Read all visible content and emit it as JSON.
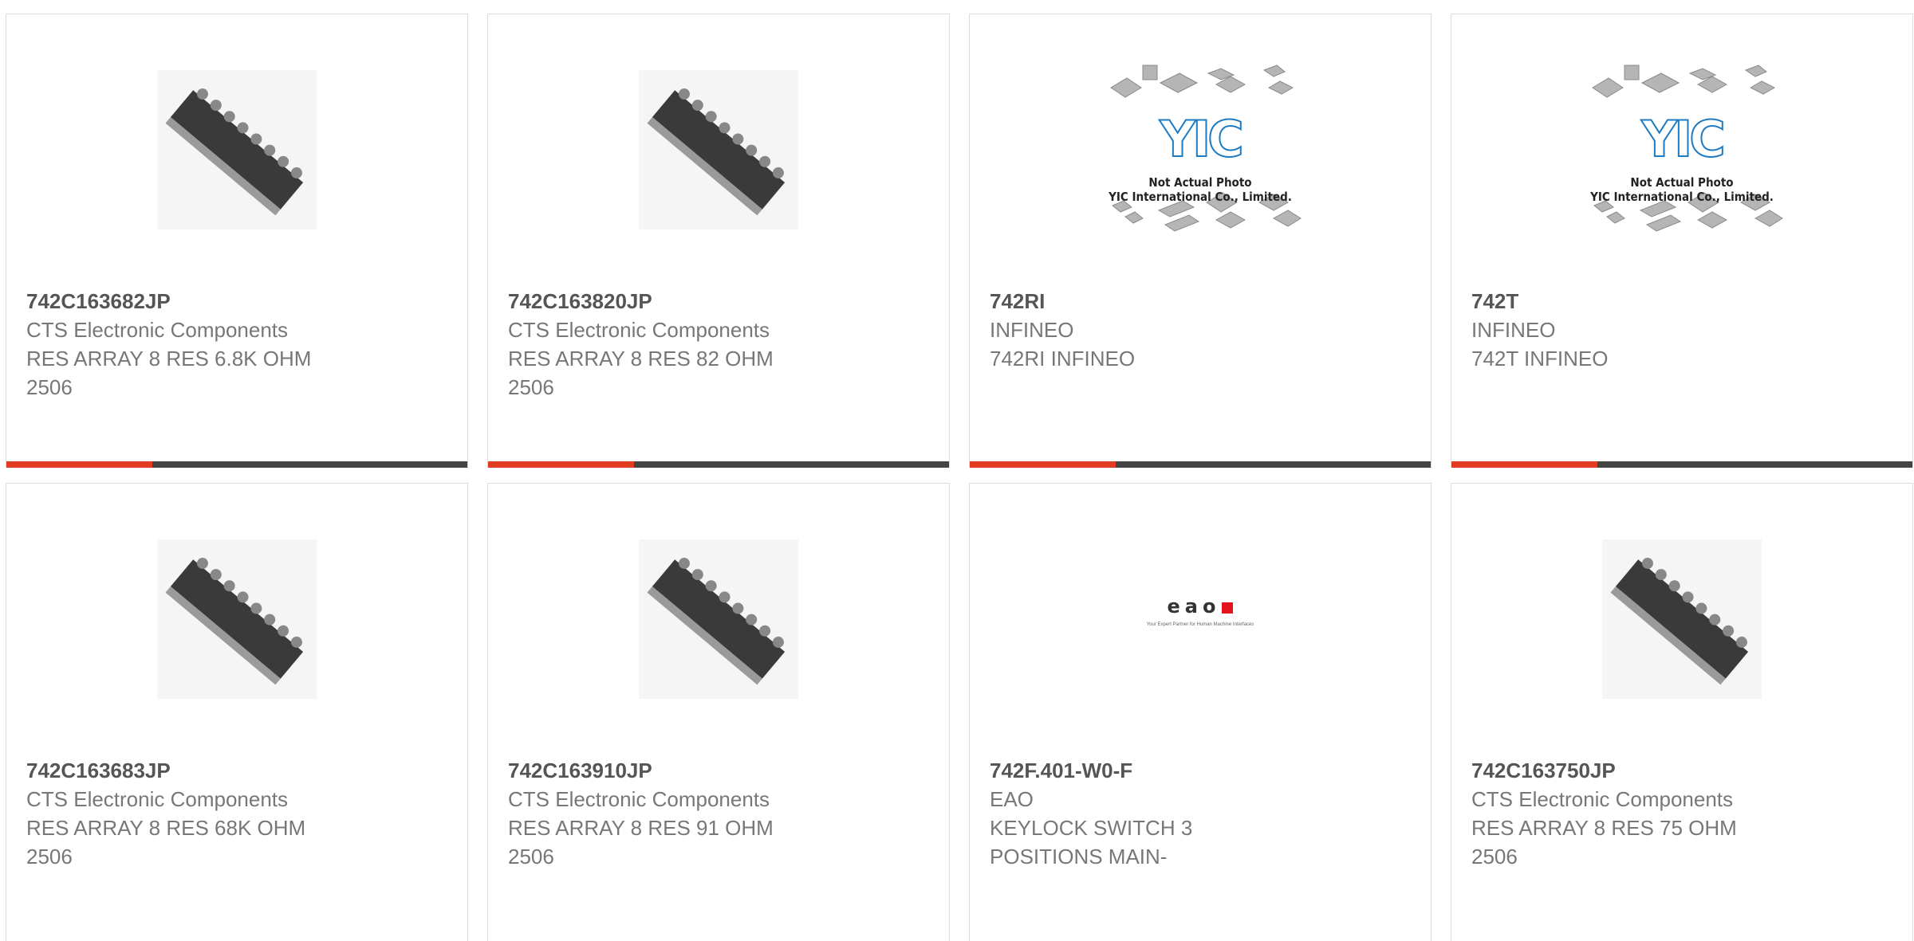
{
  "colors": {
    "accent": "#e03c1f",
    "bar": "#444444",
    "border": "#dcdcdc"
  },
  "products": [
    {
      "part": "742C163682JP",
      "maker": "CTS Electronic Components",
      "desc1": "RES ARRAY 8 RES 6.8K OHM",
      "desc2": "2506",
      "image": "resistor-array"
    },
    {
      "part": "742C163820JP",
      "maker": "CTS Electronic Components",
      "desc1": "RES ARRAY 8 RES 82 OHM",
      "desc2": "2506",
      "image": "resistor-array"
    },
    {
      "part": "742RI",
      "maker": "INFINEO",
      "desc1": "742RI INFINEO",
      "desc2": "",
      "image": "yic-placeholder"
    },
    {
      "part": "742T",
      "maker": "INFINEO",
      "desc1": "742T INFINEO",
      "desc2": "",
      "image": "yic-placeholder"
    },
    {
      "part": "742C163683JP",
      "maker": "CTS Electronic Components",
      "desc1": "RES ARRAY 8 RES 68K OHM",
      "desc2": "2506",
      "image": "resistor-array"
    },
    {
      "part": "742C163910JP",
      "maker": "CTS Electronic Components",
      "desc1": "RES ARRAY 8 RES 91 OHM",
      "desc2": "2506",
      "image": "resistor-array"
    },
    {
      "part": "742F.401-W0-F",
      "maker": "EAO",
      "desc1": "KEYLOCK SWITCH 3",
      "desc2": "POSITIONS MAIN-",
      "image": "eao-logo"
    },
    {
      "part": "742C163750JP",
      "maker": "CTS Electronic Components",
      "desc1": "RES ARRAY 8 RES 75 OHM",
      "desc2": "2506",
      "image": "resistor-array"
    }
  ],
  "placeholder": {
    "logo": "YIC",
    "line1": "Not Actual Photo",
    "line2": "YIC International Co., Limited."
  },
  "eao": {
    "word": "eao",
    "tagline": "Your Expert Partner for Human Machine Interfaces"
  }
}
